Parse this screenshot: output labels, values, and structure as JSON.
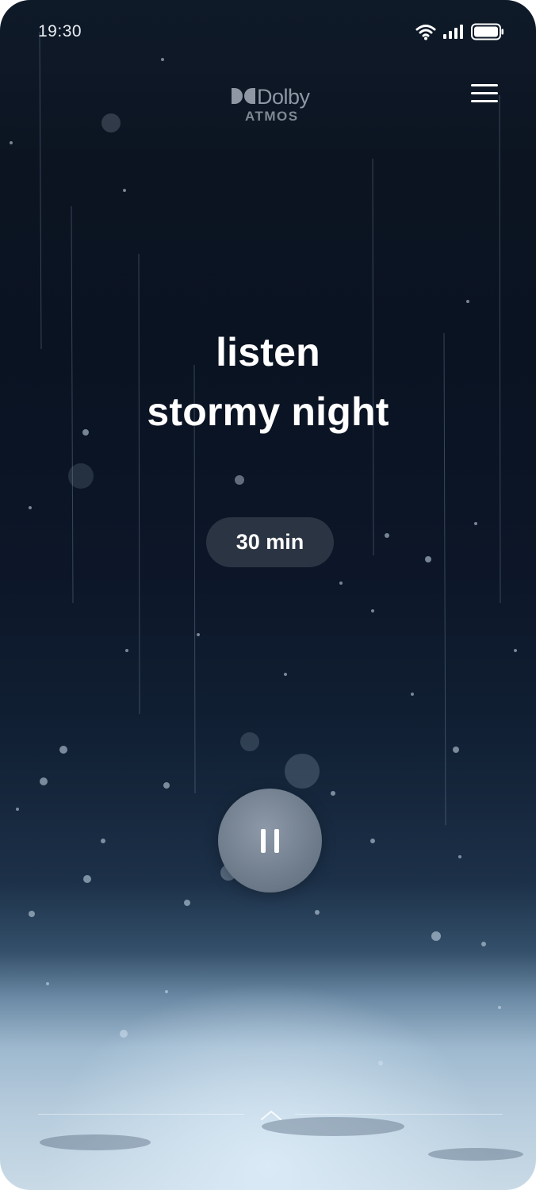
{
  "status_bar": {
    "time": "19:30",
    "icons": [
      "wifi-icon",
      "signal-icon",
      "battery-icon"
    ]
  },
  "logo": {
    "brand": "Dolby",
    "sub": "ATMOS"
  },
  "header": {
    "menu_icon": "hamburger-menu-icon"
  },
  "main": {
    "title_line1": "listen",
    "title_line2": "stormy night",
    "duration": "30 min",
    "play_state_icon": "pause-icon"
  },
  "footer": {
    "expand_icon": "chevron-up-icon"
  },
  "colors": {
    "background_top": "#0c1421",
    "background_bottom": "#c9dae6",
    "text": "#ffffff",
    "pill": "#464e5a",
    "play_button": "#7a8797"
  }
}
